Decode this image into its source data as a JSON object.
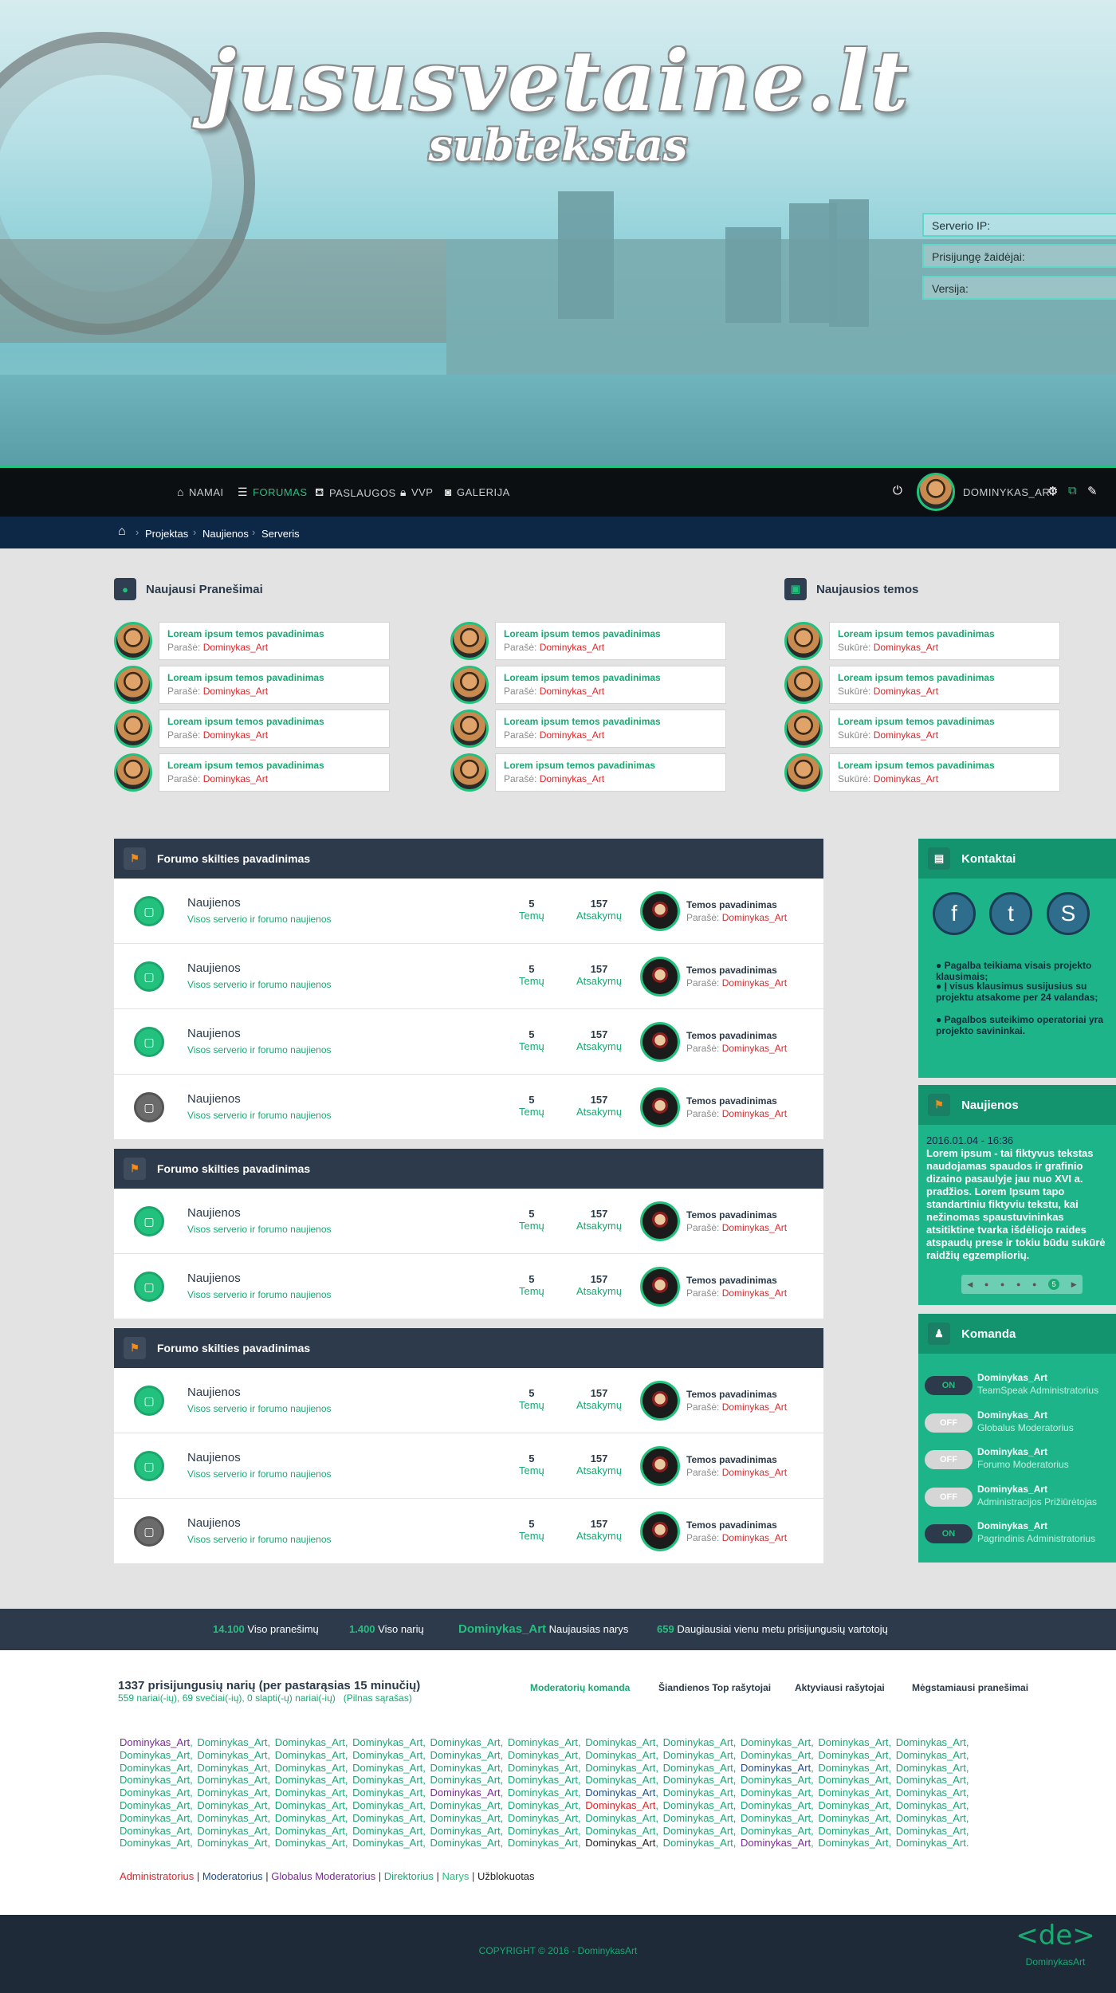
{
  "header": {
    "title": "jususvetaine.lt",
    "subtitle": "subtekstas"
  },
  "server": [
    {
      "label": "Serverio IP:"
    },
    {
      "label": "Prisijungę žaidėjai:"
    },
    {
      "label": "Versija:"
    }
  ],
  "nav": {
    "items": [
      {
        "label": "NAMAI",
        "icon": "home-icon"
      },
      {
        "label": "FORUMAS",
        "icon": "menu-icon",
        "active": true
      },
      {
        "label": "PASLAUGOS",
        "icon": "basket-icon"
      },
      {
        "label": "VVP",
        "icon": "lock-icon"
      },
      {
        "label": "GALERIJA",
        "icon": "camera-icon"
      }
    ],
    "username": "DOMINYKAS_ART"
  },
  "breadcrumb": [
    "Projektas",
    "Naujienos",
    "Serveris"
  ],
  "recent_posts": {
    "title": "Naujausi Pranešimai",
    "col1": [
      {
        "title": "Loream ipsum temos pavadinimas",
        "by_label": "Parašė:",
        "author": "Dominykas_Art"
      },
      {
        "title": "Loream ipsum temos pavadinimas",
        "by_label": "Parašė:",
        "author": "Dominykas_Art"
      },
      {
        "title": "Loream ipsum temos pavadinimas",
        "by_label": "Parašė:",
        "author": "Dominykas_Art"
      },
      {
        "title": "Loream ipsum temos pavadinimas",
        "by_label": "Parašė:",
        "author": "Dominykas_Art"
      }
    ],
    "col2": [
      {
        "title": "Loream ipsum temos pavadinimas",
        "by_label": "Parašė:",
        "author": "Dominykas_Art"
      },
      {
        "title": "Loream ipsum temos pavadinimas",
        "by_label": "Parašė:",
        "author": "Dominykas_Art"
      },
      {
        "title": "Loream ipsum temos pavadinimas",
        "by_label": "Parašė:",
        "author": "Dominykas_Art"
      },
      {
        "title": "Lorem ipsum temos pavadinimas",
        "by_label": "Parašė:",
        "author": "Dominykas_Art"
      }
    ]
  },
  "recent_topics": {
    "title": "Naujausios temos",
    "items": [
      {
        "title": "Loream ipsum temos pavadinimas",
        "by_label": "Sukūrė:",
        "author": "Dominykas_Art"
      },
      {
        "title": "Loream ipsum temos pavadinimas",
        "by_label": "Sukūrė:",
        "author": "Dominykas_Art"
      },
      {
        "title": "Loream ipsum temos pavadinimas",
        "by_label": "Sukūrė:",
        "author": "Dominykas_Art"
      },
      {
        "title": "Loream ipsum temos pavadinimas",
        "by_label": "Sukūrė:",
        "author": "Dominykas_Art"
      }
    ]
  },
  "forum_row": {
    "name": "Naujienos",
    "desc": "Visos serverio ir forumo naujienos",
    "topics": "5",
    "topics_label": "Temų",
    "replies": "157",
    "replies_label": "Atsakymų",
    "last_title": "Temos pavadinimas",
    "last_by": "Parašė:",
    "last_author": "Dominykas_Art"
  },
  "forum_sections": [
    {
      "title": "Forumo skilties pavadinimas",
      "rows": [
        "green",
        "green",
        "green",
        "gray"
      ]
    },
    {
      "title": "Forumo skilties pavadinimas",
      "rows": [
        "green",
        "green"
      ]
    },
    {
      "title": "Forumo skilties pavadinimas",
      "rows": [
        "green",
        "green",
        "gray"
      ]
    }
  ],
  "contacts": {
    "title": "Kontaktai",
    "points": [
      "Pagalba teikiama visais projekto klausimais;",
      "Į visus klausimus susijusius su projektu atsakome per 24 valandas;",
      "Pagalbos suteikimo operatoriai yra projekto savininkai."
    ]
  },
  "news": {
    "title": "Naujienos",
    "date": "2016.01.04 - 16:36",
    "text": "Lorem ipsum - tai fiktyvus tekstas naudojamas spaudos ir grafinio dizaino pasaulyje jau nuo XVI a. pradžios. Lorem Ipsum tapo standartiniu fiktyviu tekstu, kai nežinomas spaustuvininkas atsitiktine tvarka išdėliojo raides atspaudų prese ir tokiu būdu sukūrė raidžių egzempliorių.",
    "pager_prev": "◀",
    "pager_next": "▶",
    "pager_active": "5"
  },
  "team": {
    "title": "Komanda",
    "members": [
      {
        "status": "ON",
        "name": "Dominykas_Art",
        "role": "TeamSpeak Administratorius"
      },
      {
        "status": "OFF",
        "name": "Dominykas_Art",
        "role": "Globalus Moderatorius"
      },
      {
        "status": "OFF",
        "name": "Dominykas_Art",
        "role": "Forumo Moderatorius"
      },
      {
        "status": "OFF",
        "name": "Dominykas_Art",
        "role": "Administracijos Prižiūrėtojas"
      },
      {
        "status": "ON",
        "name": "Dominykas_Art",
        "role": "Pagrindinis Administratorius"
      }
    ]
  },
  "stats": [
    {
      "value": "14.100",
      "label": "Viso pranešimų"
    },
    {
      "value": "1.400",
      "label": "Viso narių"
    },
    {
      "value": "Dominykas_Art",
      "label": "Naujausias narys"
    },
    {
      "value": "659",
      "label": "Daugiausiai vienu metu prisijungusių vartotojų"
    }
  ],
  "online": {
    "title": "1337 prisijungusių narių (per pastarąsias 15 minučių)",
    "detail": "559 nariai(-ių), 69 svečiai(-ių), 0 slapti(-ų) nariai(-ių)",
    "full_list": "(Pilnas sąrašas)",
    "links": [
      "Moderatorių komanda",
      "Šiandienos Top rašytojai",
      "Aktyviausi rašytojai",
      "Mėgstamiausi pranešimai"
    ],
    "name": "Dominykas_Art",
    "name_count": 99
  },
  "legend": [
    {
      "label": "Administratorius",
      "color": "#e0262a"
    },
    {
      "label": "Moderatorius",
      "color": "#1f4f8a"
    },
    {
      "label": "Globalus Moderatorius",
      "color": "#7a2a9a"
    },
    {
      "label": "Direktorius",
      "color": "#1aa972"
    },
    {
      "label": "Narys",
      "color": "#23c17e"
    },
    {
      "label": "Užblokuotas",
      "color": "#222222"
    }
  ],
  "footer": {
    "copyright": "COPYRIGHT © 2016 - DominykasArt",
    "brand": "DominykasArt",
    "brand_mark": "<de>"
  }
}
